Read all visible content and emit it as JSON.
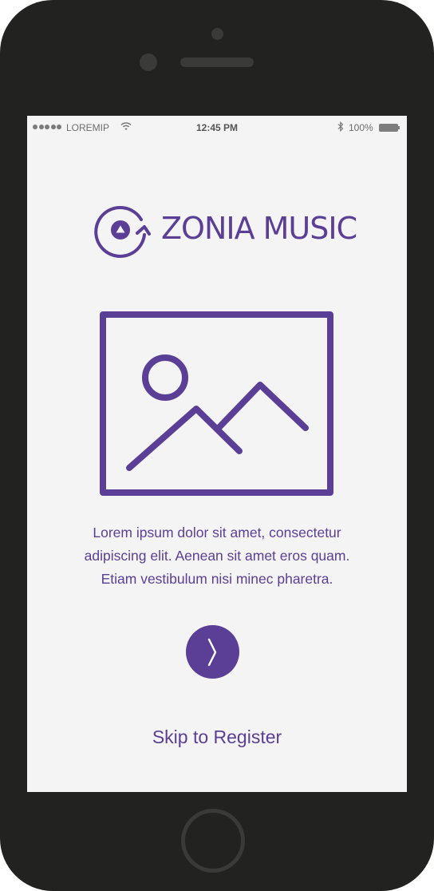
{
  "status_bar": {
    "carrier": "LOREMIP",
    "time": "12:45 PM",
    "battery": "100%",
    "signal_icon": "signal-dots-icon",
    "wifi_icon": "wifi-icon",
    "bluetooth_icon": "bluetooth-icon",
    "battery_icon": "battery-icon"
  },
  "brand": {
    "name": "ZONIA MUSIC",
    "logo_icon": "music-sync-logo-icon"
  },
  "hero": {
    "icon": "image-placeholder-icon"
  },
  "description": {
    "lines": [
      "Lorem ipsum dolor sit amet, consectetur",
      "adipiscing elit. Aenean sit amet eros quam.",
      "Etiam vestibulum nisi minec pharetra."
    ]
  },
  "actions": {
    "next_icon": "chevron-right-icon",
    "skip_label": "Skip to Register"
  },
  "colors": {
    "accent": "#5b3f96",
    "screen_background": "#f4f4f5",
    "device_body": "#222220"
  }
}
